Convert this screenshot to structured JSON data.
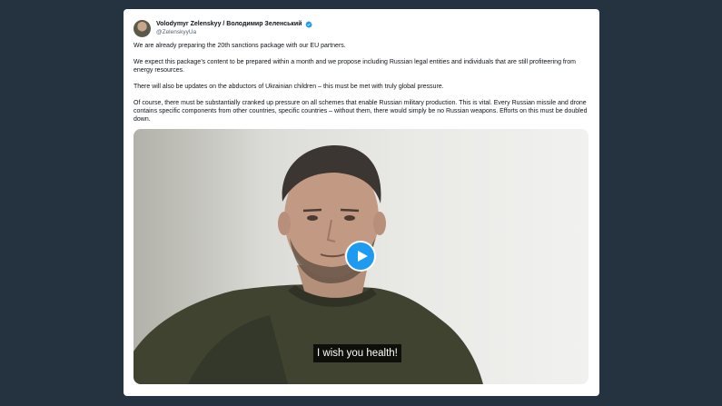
{
  "tweet": {
    "author": {
      "display_name": "Volodymyr Zelenskyy / Володимир Зеленський",
      "handle": "@ZelenskyyUa",
      "verified": true
    },
    "paragraphs": [
      "We are already preparing the 20th sanctions package with our EU partners.",
      "We expect this package’s content to be prepared within a month and we propose including Russian legal entities and individuals that are still profiteering from energy resources.",
      "There will also be updates on the abductors of Ukrainian children – this must be met with truly global pressure.",
      "Of course, there must be substantially cranked up pressure on all schemes that enable Russian military production. This is vital. Every Russian missile and drone contains specific components from other countries, specific countries – without them, there would simply be no Russian weapons. Efforts on this must be doubled down."
    ],
    "video": {
      "subtitle": "I wish you health!",
      "play_icon": "play-icon"
    }
  },
  "colors": {
    "page_background": "#253341",
    "card_background": "#ffffff",
    "accent": "#1d9bf0",
    "text": "#0f1419",
    "muted": "#536471"
  }
}
